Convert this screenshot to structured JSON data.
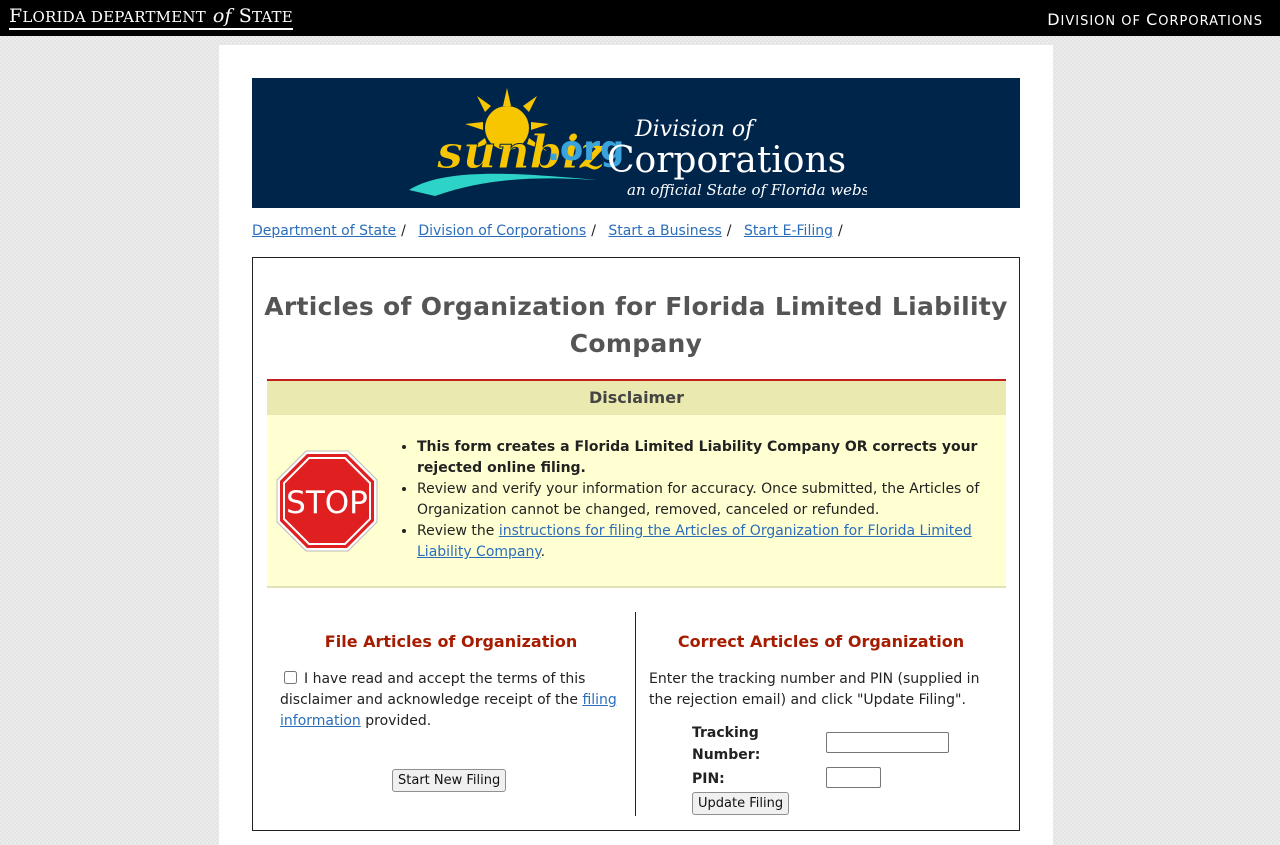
{
  "topbar": {
    "agency_prefix": "F",
    "agency_rest": "LORIDA DEPARTMENT",
    "agency_of": "of",
    "agency_state_initial": "S",
    "agency_state_rest": "TATE",
    "division_initial": "D",
    "division_rest": "IVISION OF",
    "corp_initial": "C",
    "corp_rest": "ORPORATIONS"
  },
  "banner": {
    "logo_text": "sunbiz",
    "logo_domain": ".org",
    "division_line": "Division of",
    "corporations_line": "Corporations",
    "tagline": "an official State of Florida website"
  },
  "breadcrumb": [
    {
      "label": "Department of State"
    },
    {
      "label": "Division of Corporations"
    },
    {
      "label": "Start a Business"
    },
    {
      "label": "Start E-Filing"
    }
  ],
  "breadcrumb_sep": "/",
  "title_line1": "Articles of Organization for Florida Limited Liability",
  "title_line2": "Company",
  "disclaimer": {
    "heading": "Disclaimer",
    "stop_sign_text": "STOP",
    "item1": "This form creates a Florida Limited Liability Company OR corrects your rejected online filing.",
    "item2": "Review and verify your information for accuracy. Once submitted, the Articles of Organization cannot be changed, removed, canceled or refunded.",
    "item3_prefix": "Review the ",
    "item3_link": "instructions for filing the Articles of Organization for Florida Limited Liability Company",
    "item3_suffix": "."
  },
  "file_section": {
    "heading": "File Articles of Organization",
    "accept_text": "I have read and accept the terms of this disclaimer and acknowledge receipt of the ",
    "accept_link": "filing information",
    "accept_suffix": " provided.",
    "start_button": "Start New Filing"
  },
  "correct_section": {
    "heading": "Correct Articles of Organization",
    "instructions": "Enter the tracking number and PIN (supplied in the rejection email) and click \"Update Filing\".",
    "tracking_label_1": "Tracking",
    "tracking_label_2": "Number:",
    "tracking_value": "",
    "pin_label": "PIN:",
    "pin_value": "",
    "update_button": "Update Filing"
  },
  "colors": {
    "topbar": "#000000",
    "banner": "#00254a",
    "link": "#2a6ebb",
    "heading_red": "#a61c00",
    "disclaimer_head": "#eaeab0",
    "disclaimer_body": "#ffffd1",
    "disclaimer_rule": "#c21f1f"
  }
}
